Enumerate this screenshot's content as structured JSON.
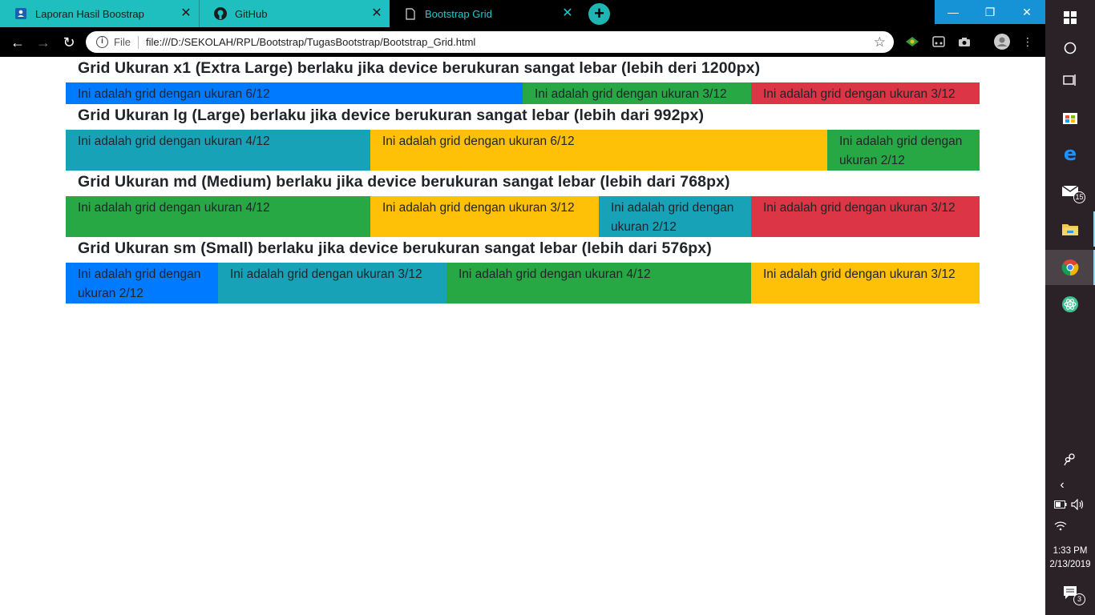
{
  "browser": {
    "tabs": [
      {
        "label": "Laporan Hasil Boostrap",
        "icon": "classroom-icon"
      },
      {
        "label": "GitHub",
        "icon": "github-icon"
      },
      {
        "label": "Bootstrap Grid",
        "icon": "document-icon",
        "active": true
      }
    ],
    "new_tab": "+",
    "address": {
      "scheme_label": "File",
      "url": "file:///D:/SEKOLAH/RPL/Bootstrap/TugasBootstrap/Bootstrap_Grid.html"
    }
  },
  "page": {
    "sections": [
      {
        "heading": "Grid Ukuran x1 (Extra Large) berlaku jika device berukuran sangat lebar (lebih deri 1200px)",
        "cols": [
          {
            "text": "Ini adalah grid dengan ukuran 6/12",
            "span": 6,
            "color": "blue"
          },
          {
            "text": "Ini adalah grid dengan ukuran 3/12",
            "span": 3,
            "color": "green"
          },
          {
            "text": "Ini adalah grid dengan ukuran 3/12",
            "span": 3,
            "color": "red"
          }
        ]
      },
      {
        "heading": "Grid Ukuran lg (Large) berlaku jika device berukuran sangat lebar (lebih dari 992px)",
        "cols": [
          {
            "text": "Ini adalah grid dengan ukuran 4/12",
            "span": 4,
            "color": "teal"
          },
          {
            "text": "Ini adalah grid dengan ukuran 6/12",
            "span": 6,
            "color": "yellow"
          },
          {
            "text": "Ini adalah grid dengan ukuran 2/12",
            "span": 2,
            "color": "green"
          }
        ]
      },
      {
        "heading": "Grid Ukuran md (Medium) berlaku jika device berukuran sangat lebar (lebih dari 768px)",
        "cols": [
          {
            "text": "Ini adalah grid dengan ukuran 4/12",
            "span": 4,
            "color": "green"
          },
          {
            "text": "Ini adalah grid dengan ukuran 3/12",
            "span": 3,
            "color": "yellow"
          },
          {
            "text": "Ini adalah grid dengan ukuran 2/12",
            "span": 2,
            "color": "teal"
          },
          {
            "text": "Ini adalah grid dengan ukuran 3/12",
            "span": 3,
            "color": "red"
          }
        ]
      },
      {
        "heading": "Grid Ukuran sm (Small) berlaku jika device berukuran sangat lebar (lebih dari 576px)",
        "cols": [
          {
            "text": "Ini adalah grid dengan ukuran 2/12",
            "span": 2,
            "color": "blue"
          },
          {
            "text": "Ini adalah grid dengan ukuran 3/12",
            "span": 3,
            "color": "teal"
          },
          {
            "text": "Ini adalah grid dengan ukuran 4/12",
            "span": 4,
            "color": "green"
          },
          {
            "text": "Ini adalah grid dengan ukuran 3/12",
            "span": 3,
            "color": "yellow"
          }
        ]
      }
    ]
  },
  "taskbar": {
    "mail_badge": "15",
    "notification_badge": "3",
    "time": "1:33 PM",
    "date": "2/13/2019"
  },
  "colors": {
    "tab_teal": "#20bfbf",
    "blue": "#007bff",
    "green": "#28a745",
    "red": "#dc3545",
    "yellow": "#ffc107",
    "teal": "#17a2b8"
  }
}
